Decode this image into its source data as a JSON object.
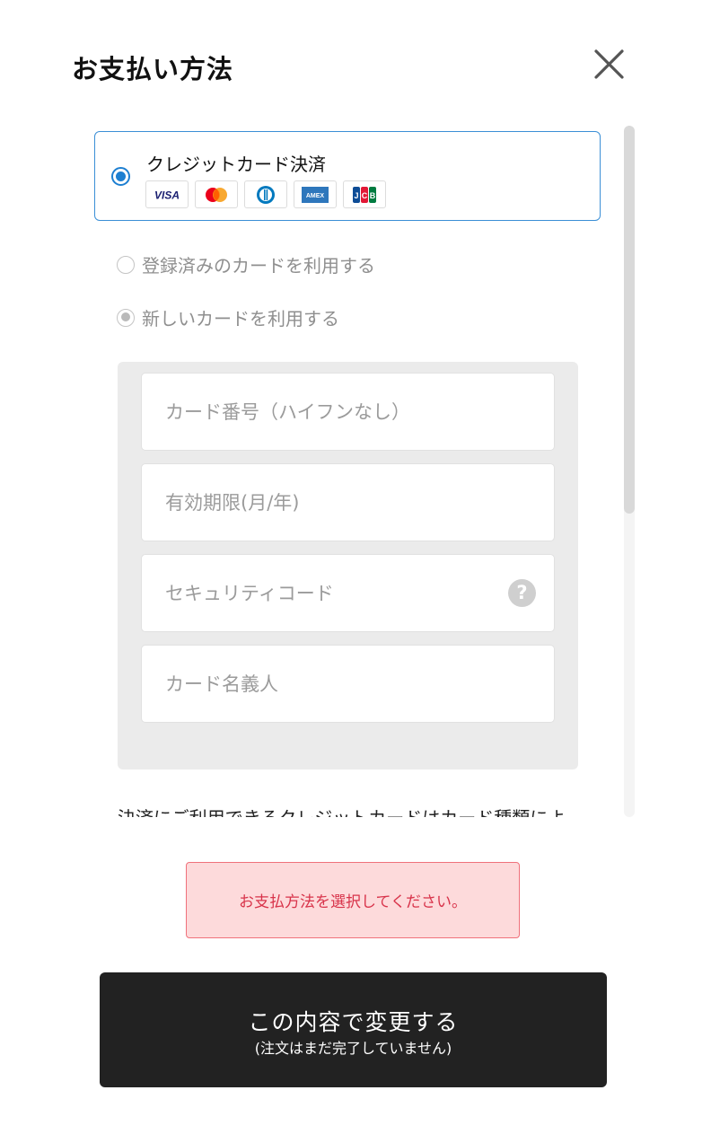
{
  "header": {
    "title": "お支払い方法"
  },
  "payment_method": {
    "label": "クレジットカード決済",
    "brands": [
      "VISA",
      "Mastercard",
      "Diners",
      "AMEX",
      "JCB"
    ]
  },
  "card_options": {
    "registered_label": "登録済みのカードを利用する",
    "new_label": "新しいカードを利用する"
  },
  "form": {
    "card_number_placeholder": "カード番号（ハイフンなし）",
    "expiry_placeholder": "有効期限(月/年)",
    "security_code_placeholder": "セキュリティコード",
    "card_holder_placeholder": "カード名義人",
    "help_symbol": "?"
  },
  "note": {
    "text": "決済にご利用できるクレジットカードはカード種類によ"
  },
  "error": {
    "message": "お支払方法を選択してください。"
  },
  "submit": {
    "main_label": "この内容で変更する",
    "sub_label": "(注文はまだ完了していません)"
  },
  "colors": {
    "accent": "#1d7fd1",
    "error_text": "#d8334a",
    "error_bg": "#fddadb",
    "button_bg": "#222222"
  }
}
